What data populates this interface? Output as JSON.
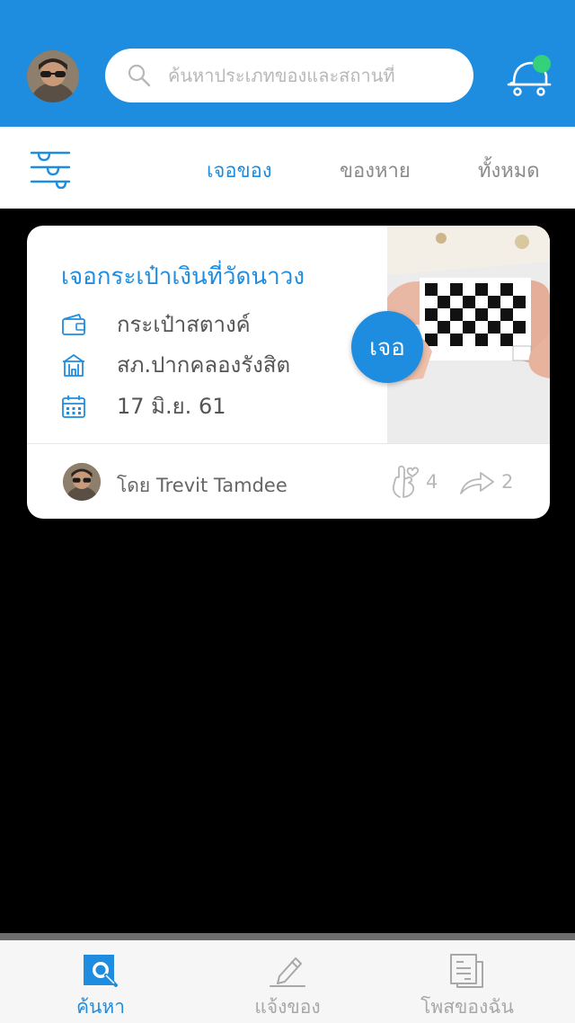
{
  "header": {
    "search_placeholder": "ค้นหาประเภทของและสถานที่",
    "colors": {
      "primary": "#1e8de0",
      "notification_dot": "#33d17a"
    },
    "icons": [
      "avatar",
      "search-icon",
      "cart-icon"
    ]
  },
  "tabs": {
    "filter_icon": "filter-sliders-icon",
    "items": [
      {
        "label": "เจอของ",
        "active": true
      },
      {
        "label": "ของหาย",
        "active": false
      },
      {
        "label": "ทั้งหมด",
        "active": false
      }
    ]
  },
  "card": {
    "title": "เจอกระเป๋าเงินที่วัดนาวง",
    "category": "กระเป๋าสตางค์",
    "location": "สภ.ปากคลองรังสิต",
    "date": "17 มิ.ย. 61",
    "badge": "เจอ",
    "author": "โดย  Trevit  Tamdee",
    "likes": "4",
    "shares": "2"
  },
  "bottom_nav": {
    "items": [
      {
        "label": "ค้นหา",
        "icon": "search-tab-icon",
        "active": true
      },
      {
        "label": "แจ้งของ",
        "icon": "pencil-icon",
        "active": false
      },
      {
        "label": "โพสของฉัน",
        "icon": "document-icon",
        "active": false
      }
    ]
  }
}
